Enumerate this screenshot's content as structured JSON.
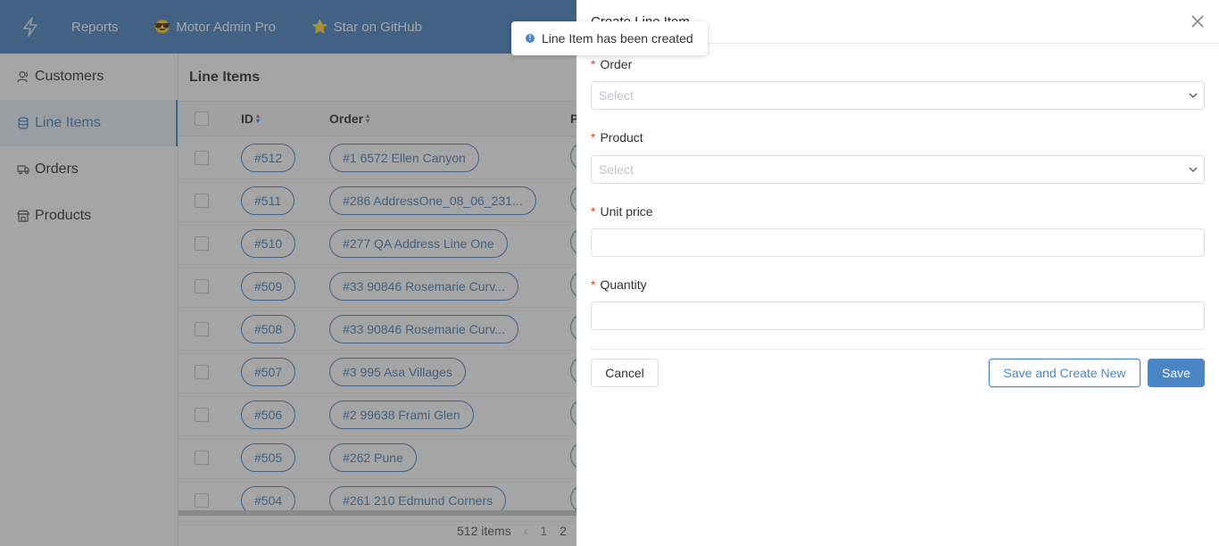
{
  "topbar": {
    "logo_icon": "bolt-icon",
    "links": [
      {
        "label": "Reports",
        "emoji": ""
      },
      {
        "label": "Motor Admin Pro",
        "emoji": "😎"
      },
      {
        "label": "Star on GitHub",
        "emoji": "⭐"
      }
    ]
  },
  "sidebar": {
    "items": [
      {
        "label": "Customers",
        "icon": "user-icon"
      },
      {
        "label": "Line Items",
        "icon": "database-icon"
      },
      {
        "label": "Orders",
        "icon": "truck-icon"
      },
      {
        "label": "Products",
        "icon": "store-icon"
      }
    ],
    "active": "Line Items"
  },
  "main": {
    "title": "Line Items",
    "columns": {
      "id": "ID",
      "order": "Order",
      "product_fragment": "P"
    },
    "rows": [
      {
        "id": "#512",
        "order": "#1 6572 Ellen Canyon"
      },
      {
        "id": "#511",
        "order": "#286 AddressOne_08_06_231..."
      },
      {
        "id": "#510",
        "order": "#277 QA Address Line One"
      },
      {
        "id": "#509",
        "order": "#33 90846 Rosemarie Curv..."
      },
      {
        "id": "#508",
        "order": "#33 90846 Rosemarie Curv..."
      },
      {
        "id": "#507",
        "order": "#3 995 Asa Villages"
      },
      {
        "id": "#506",
        "order": "#2 99638 Frami Glen"
      },
      {
        "id": "#505",
        "order": "#262 Pune"
      },
      {
        "id": "#504",
        "order": "#261 210 Edmund Corners"
      }
    ],
    "pager": {
      "total": "512 items",
      "prev": "‹",
      "current_page": "1",
      "next_page": "2"
    }
  },
  "drawer": {
    "title": "Create Line Item",
    "fields": [
      {
        "label": "Order",
        "required": "*",
        "placeholder": "Select",
        "type": "select"
      },
      {
        "label": "Product",
        "required": "*",
        "placeholder": "Select",
        "type": "select"
      },
      {
        "label": "Unit price",
        "required": "*",
        "placeholder": "",
        "type": "text"
      },
      {
        "label": "Quantity",
        "required": "*",
        "placeholder": "",
        "type": "text"
      }
    ],
    "buttons": {
      "cancel": "Cancel",
      "save_new": "Save and Create New",
      "save": "Save"
    }
  },
  "toast": {
    "message": "Line Item has been created",
    "icon": "info-icon"
  },
  "colors": {
    "primary": "#4a86c5",
    "required": "#ed4014"
  }
}
